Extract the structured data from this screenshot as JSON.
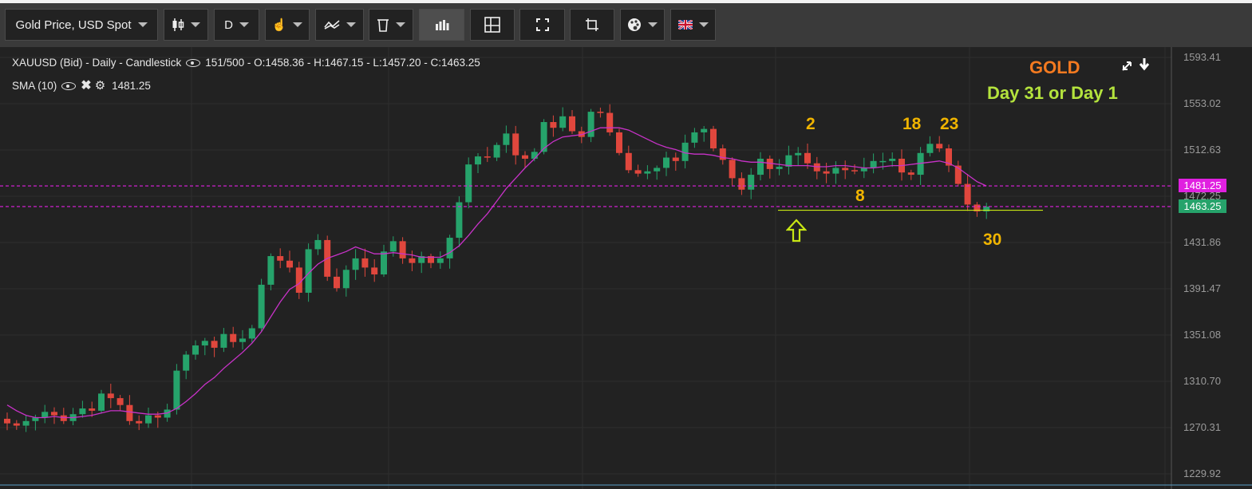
{
  "toolbar": {
    "instrument_label": "Gold Price, USD Spot",
    "timeframe_label": "D",
    "buttons": [
      {
        "name": "chart-type-button",
        "icon": "candlestick-icon",
        "has_caret": true
      },
      {
        "name": "timeframe-button",
        "label_key": "D",
        "has_caret": true
      },
      {
        "name": "drawing-tools-button",
        "icon": "hand-pointer-icon",
        "has_caret": true
      },
      {
        "name": "indicators-button",
        "icon": "indicator-icon",
        "has_caret": true
      },
      {
        "name": "delete-button",
        "icon": "trash-icon",
        "has_caret": true
      },
      {
        "name": "volume-button",
        "icon": "bar-chart-icon",
        "has_caret": false,
        "active": true
      },
      {
        "name": "layout-button",
        "icon": "layout-grid-icon",
        "has_caret": false
      },
      {
        "name": "fullscreen-button",
        "icon": "fullscreen-icon",
        "has_caret": false
      },
      {
        "name": "crop-button",
        "icon": "crop-icon",
        "has_caret": false
      },
      {
        "name": "theme-button",
        "icon": "palette-icon",
        "has_caret": true
      },
      {
        "name": "language-button",
        "icon": "uk-flag-icon",
        "has_caret": true
      }
    ]
  },
  "header": {
    "series_info": "XAUUSD (Bid) - Daily - Candlestick",
    "ohlc": "151/500 - O:1458.36 - H:1467.15 - L:1457.20 - C:1463.25",
    "sma_label": "SMA (10)",
    "sma_value": "1481.25"
  },
  "annotations": {
    "title": "GOLD",
    "subtitle": "Day 31 or Day 1",
    "counts": [
      "2",
      "8",
      "18",
      "23",
      "30"
    ],
    "title_color": "#f47a20",
    "subtitle_color": "#b4e33d",
    "count_color": "#f0b400"
  },
  "colors": {
    "up": "#26a36b",
    "down": "#e0473d",
    "sma": "#c832c8",
    "level_line": "#e020e0",
    "support_line": "#c8e614",
    "sma_tag": "#e020e0",
    "price_tag": "#26a36b"
  },
  "chart_data": {
    "type": "candlestick",
    "title": "XAUUSD (Bid) - Daily - Candlestick",
    "y_ticks": [
      "1593.41",
      "1553.02",
      "1512.63",
      "1472.25",
      "1431.86",
      "1391.47",
      "1351.08",
      "1310.70",
      "1270.31",
      "1229.92"
    ],
    "y_tick_values": [
      1593.41,
      1553.02,
      1512.63,
      1472.25,
      1431.86,
      1391.47,
      1351.08,
      1310.7,
      1270.31,
      1229.92
    ],
    "ylim": [
      1229.92,
      1593.41
    ],
    "grid": true,
    "horizontal_levels": [
      {
        "name": "SMA (10)",
        "value": 1481.25,
        "label": "1481.25"
      },
      {
        "name": "Close",
        "value": 1463.25,
        "label": "1463.25"
      }
    ],
    "support_level": 1460.0,
    "close_series": [
      1274,
      1272,
      1276,
      1279,
      1284,
      1281,
      1276,
      1282,
      1287,
      1285,
      1300,
      1296,
      1290,
      1276,
      1274,
      1281,
      1279,
      1286,
      1320,
      1334,
      1342,
      1346,
      1340,
      1352,
      1345,
      1348,
      1357,
      1395,
      1420,
      1416,
      1410,
      1388,
      1426,
      1434,
      1402,
      1392,
      1408,
      1418,
      1410,
      1404,
      1424,
      1433,
      1418,
      1414,
      1420,
      1414,
      1418,
      1436,
      1467,
      1500,
      1507,
      1506,
      1517,
      1527,
      1508,
      1505,
      1511,
      1537,
      1532,
      1542,
      1529,
      1524,
      1546,
      1545,
      1528,
      1510,
      1495,
      1492,
      1494,
      1497,
      1506,
      1503,
      1519,
      1528,
      1531,
      1514,
      1504,
      1488,
      1478,
      1491,
      1505,
      1496,
      1498,
      1508,
      1510,
      1501,
      1494,
      1492,
      1497,
      1495,
      1494,
      1497,
      1503,
      1503,
      1505,
      1493,
      1491,
      1510,
      1518,
      1514,
      1499,
      1483,
      1465,
      1459,
      1463.25
    ],
    "sma_series": [
      1290,
      1285,
      1281,
      1279,
      1279,
      1280,
      1279,
      1279,
      1280,
      1281,
      1283,
      1285,
      1285,
      1284,
      1283,
      1282,
      1282,
      1283,
      1287,
      1293,
      1300,
      1308,
      1314,
      1322,
      1329,
      1336,
      1344,
      1354,
      1367,
      1380,
      1391,
      1396,
      1405,
      1413,
      1418,
      1421,
      1424,
      1428,
      1425,
      1422,
      1422,
      1423,
      1422,
      1421,
      1419,
      1419,
      1419,
      1423,
      1429,
      1438,
      1448,
      1457,
      1468,
      1479,
      1488,
      1497,
      1505,
      1514,
      1520,
      1524,
      1525,
      1526,
      1529,
      1532,
      1532,
      1532,
      1530,
      1526,
      1522,
      1518,
      1515,
      1513,
      1510,
      1509,
      1509,
      1508,
      1506,
      1505,
      1503,
      1502,
      1502,
      1501,
      1500,
      1499,
      1499,
      1499,
      1498,
      1498,
      1499,
      1499,
      1498,
      1497,
      1497,
      1498,
      1499,
      1499,
      1500,
      1501,
      1502,
      1503,
      1501,
      1497,
      1491,
      1485,
      1481.25
    ],
    "last_ohlc": {
      "open": 1458.36,
      "high": 1467.15,
      "low": 1457.2,
      "close": 1463.25
    }
  }
}
